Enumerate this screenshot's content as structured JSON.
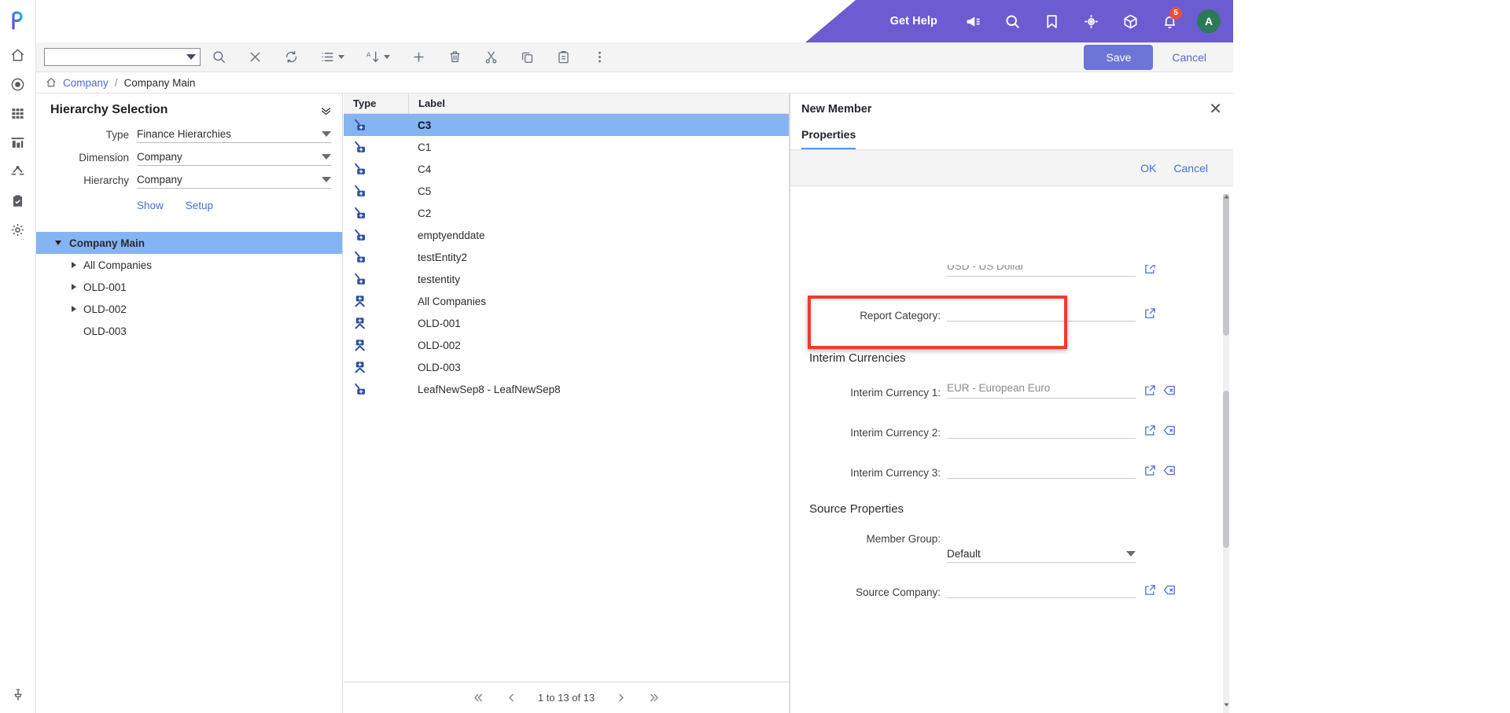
{
  "header": {
    "get_help": "Get Help",
    "notification_count": "5",
    "avatar_initial": "A",
    "icons": [
      "megaphone-icon",
      "search-icon",
      "bookmark-icon",
      "target-icon",
      "cube-icon",
      "bell-icon"
    ],
    "accent_color": "#6c5cd1"
  },
  "rail": {
    "items": [
      "home-icon",
      "eye-icon",
      "grid-icon",
      "chart-icon",
      "hierarchy-icon",
      "clipboard-check-icon",
      "gear-icon"
    ],
    "pin": "pin-icon"
  },
  "toolbar": {
    "combo_value": "",
    "buttons": [
      "search-icon",
      "close-icon",
      "refresh-icon",
      "list-icon",
      "sort-az-icon",
      "plus-icon",
      "trash-icon",
      "cut-icon",
      "copy-icon",
      "paste-icon",
      "more-icon"
    ],
    "save_label": "Save",
    "cancel_label": "Cancel"
  },
  "breadcrumb": {
    "home": "home-icon",
    "root": "Company",
    "separator": "/",
    "current": "Company Main"
  },
  "hierarchy_panel": {
    "title": "Hierarchy Selection",
    "fields": [
      {
        "label": "Type",
        "value": "Finance Hierarchies"
      },
      {
        "label": "Dimension",
        "value": "Company"
      },
      {
        "label": "Hierarchy",
        "value": "Company"
      }
    ],
    "links": [
      "Show",
      "Setup"
    ],
    "tree": [
      {
        "label": "Company Main",
        "level": 0,
        "expanded": true,
        "selected": true,
        "has_children": true
      },
      {
        "label": "All Companies",
        "level": 1,
        "expanded": false,
        "selected": false,
        "has_children": true
      },
      {
        "label": "OLD-001",
        "level": 1,
        "expanded": false,
        "selected": false,
        "has_children": true
      },
      {
        "label": "OLD-002",
        "level": 1,
        "expanded": false,
        "selected": false,
        "has_children": true
      },
      {
        "label": "OLD-003",
        "level": 1,
        "expanded": false,
        "selected": false,
        "has_children": false
      }
    ]
  },
  "grid": {
    "columns": [
      "Type",
      "Label"
    ],
    "rows": [
      {
        "type": "leaf-member-icon",
        "label": "C3",
        "selected": true
      },
      {
        "type": "leaf-member-icon",
        "label": "C1",
        "selected": false
      },
      {
        "type": "leaf-member-icon",
        "label": "C4",
        "selected": false
      },
      {
        "type": "leaf-member-icon",
        "label": "C5",
        "selected": false
      },
      {
        "type": "leaf-member-icon",
        "label": "C2",
        "selected": false
      },
      {
        "type": "leaf-member-icon",
        "label": "emptyenddate",
        "selected": false
      },
      {
        "type": "leaf-member-icon",
        "label": "testEntity2",
        "selected": false
      },
      {
        "type": "leaf-member-icon",
        "label": "testentity",
        "selected": false
      },
      {
        "type": "parent-member-icon",
        "label": "All Companies",
        "selected": false
      },
      {
        "type": "parent-member-icon",
        "label": "OLD-001",
        "selected": false
      },
      {
        "type": "parent-member-icon",
        "label": "OLD-002",
        "selected": false
      },
      {
        "type": "parent-member-icon",
        "label": "OLD-003",
        "selected": false
      },
      {
        "type": "leaf-member-icon",
        "label": "LeafNewSep8 - LeafNewSep8",
        "selected": false
      }
    ],
    "pagination": {
      "status": "1 to 13 of 13"
    }
  },
  "right_panel": {
    "title": "New Member",
    "tab": "Properties",
    "ok_label": "OK",
    "cancel_label": "Cancel",
    "scrolled_field": {
      "value": "USD - US Dollar"
    },
    "report_category": {
      "label": "Report Category:",
      "value": ""
    },
    "interim_currencies": {
      "heading": "Interim Currencies",
      "items": [
        {
          "label": "Interim Currency 1:",
          "value": "EUR - European Euro",
          "highlighted": true
        },
        {
          "label": "Interim Currency 2:",
          "value": "",
          "highlighted": false
        },
        {
          "label": "Interim Currency 3:",
          "value": "",
          "highlighted": false
        }
      ]
    },
    "source_properties": {
      "heading": "Source Properties",
      "member_group": {
        "label": "Member Group:",
        "value": "Default"
      },
      "source_company": {
        "label": "Source Company:",
        "value": ""
      }
    },
    "highlight_color": "#ef3b2d"
  }
}
